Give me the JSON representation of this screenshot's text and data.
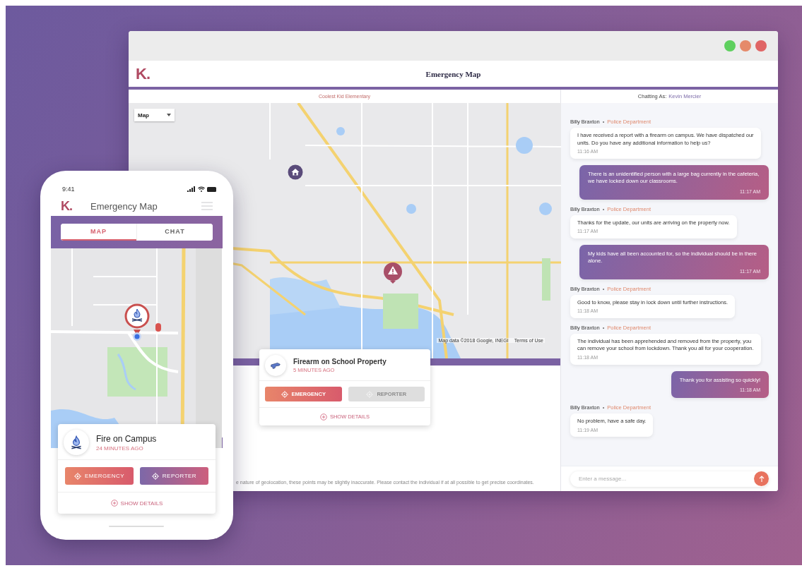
{
  "desktop": {
    "title": "Emergency Map",
    "logo": "K.",
    "school": "Coolest Kid Elementary",
    "map_type": "Map",
    "map_credit": "Map data ©2018 Google, INEGI",
    "map_terms": "Terms of Use",
    "incident": {
      "kind": "firearm",
      "title": "Firearm on School Property",
      "time": "5 MINUTES AGO",
      "details": "SHOW DETAILS",
      "buttons": [
        {
          "kind": "emergency",
          "label": "EMERGENCY",
          "disabled": false
        },
        {
          "kind": "reporter",
          "label": "REPORTER",
          "disabled": true
        }
      ]
    },
    "footnote": "e nature of geolocation, these points may be slightly inaccurate. Please contact the individual if at all possible to get precise coordinates."
  },
  "chat": {
    "label": "Chatting As:",
    "user": "Kevin Mercier",
    "placeholder": "Enter a message...",
    "messages": [
      {
        "kind": "incoming",
        "sender": "Billy Braxton",
        "separator": "•",
        "org": "Police Department",
        "text": "I have received a report with a firearm on campus. We have dispatched our units. Do you have any additional information to help us?",
        "time": "11:16 AM"
      },
      {
        "kind": "outgoing",
        "text": "There is an unidentified person with a large bag currently in the cafeteria, we have locked down our classrooms.",
        "time": "11:17 AM"
      },
      {
        "kind": "incoming",
        "sender": "Billy Braxton",
        "separator": "•",
        "org": "Police Department",
        "text": "Thanks for the update, our units are arriving on the property now.",
        "time": "11:17 AM"
      },
      {
        "kind": "outgoing",
        "text": "My kids have all been accounted for, so the individual should be in there alone.",
        "time": "11:17 AM"
      },
      {
        "kind": "incoming",
        "sender": "Billy Braxton",
        "separator": "•",
        "org": "Police Department",
        "text": "Good to know, please stay in lock down until further instructions.",
        "time": "11:18 AM"
      },
      {
        "kind": "incoming",
        "sender": "Billy Braxton",
        "separator": "•",
        "org": "Police Department",
        "text": "The individual has been apprehended and removed from the property, you can remove your school from lockdown. Thank you all for your cooperation.",
        "time": "11:18 AM"
      },
      {
        "kind": "outgoing",
        "text": "Thank you for assisting so quickly!",
        "time": "11:18 AM"
      },
      {
        "kind": "incoming",
        "sender": "Billy Braxton",
        "separator": "•",
        "org": "Police Department",
        "text": "No problem, have a safe day.",
        "time": "11:19 AM"
      }
    ]
  },
  "phone": {
    "time": "9:41",
    "logo": "K.",
    "title": "Emergency Map",
    "tabs": [
      {
        "label": "MAP",
        "selected": true
      },
      {
        "label": "CHAT",
        "selected": false
      }
    ],
    "incident": {
      "kind": "fire",
      "title": "Fire on Campus",
      "time": "24 MINUTES AGO",
      "details": "SHOW DETAILS",
      "buttons": [
        {
          "kind": "emergency",
          "label": "EMERGENCY",
          "disabled": false
        },
        {
          "kind": "reporter",
          "label": "REPORTER",
          "disabled": false
        }
      ]
    }
  }
}
